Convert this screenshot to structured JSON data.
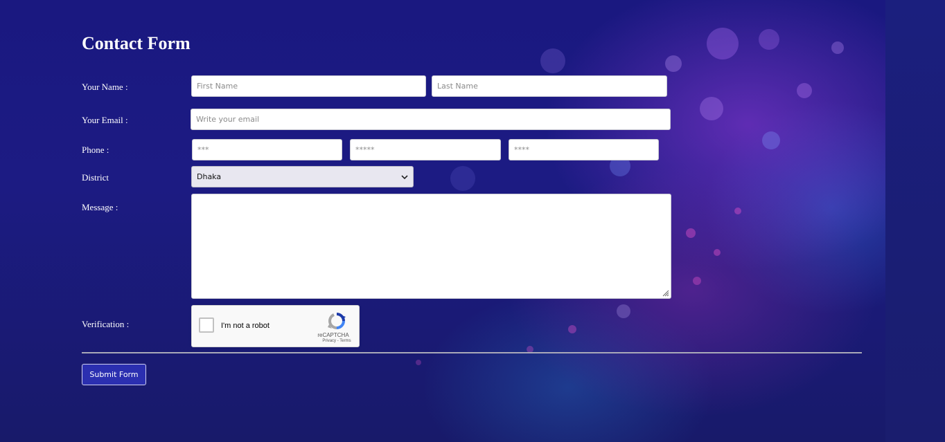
{
  "form": {
    "title": "Contact Form",
    "name": {
      "label": "Your Name :",
      "first_placeholder": "First Name",
      "last_placeholder": "Last Name"
    },
    "email": {
      "label": "Your Email :",
      "placeholder": "Write your email"
    },
    "phone": {
      "label": "Phone :",
      "part1_placeholder": "***",
      "part2_placeholder": "*****",
      "part3_placeholder": "****"
    },
    "district": {
      "label": "District",
      "selected": "Dhaka"
    },
    "message": {
      "label": "Message :",
      "value": ""
    },
    "verification": {
      "label": "Verification :",
      "checkbox_text": "I'm not a robot",
      "brand": "reCAPTCHA",
      "links": "Privacy - Terms"
    },
    "submit_label": "Submit Form"
  },
  "colors": {
    "submit_bg": "#2b2fb0",
    "page_bg": "#1c1b83",
    "recaptcha_blue": "#1c3aa9",
    "recaptcha_gray": "#a6a6a6"
  }
}
